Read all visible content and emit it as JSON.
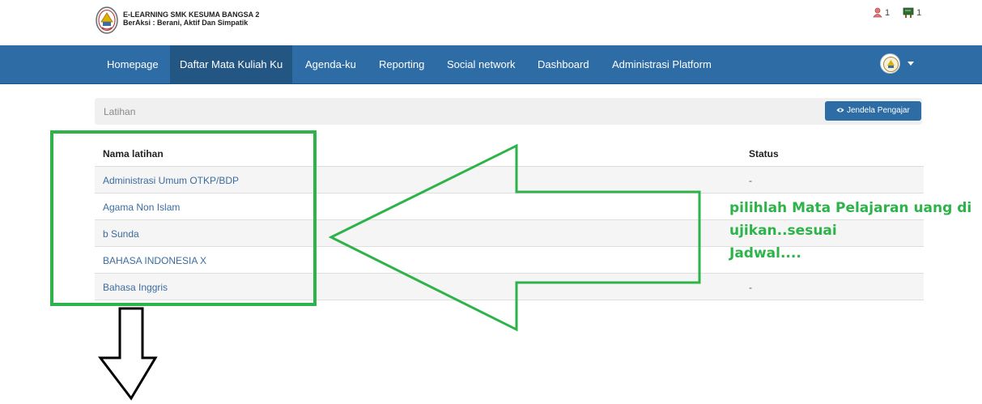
{
  "brand": {
    "title": "E-LEARNING SMK KESUMA BANGSA 2",
    "subtitle": "BerAksi : Berani, Aktif Dan Simpatik"
  },
  "counters": {
    "users": "1",
    "messages": "1"
  },
  "nav": {
    "items": [
      "Homepage",
      "Daftar Mata Kuliah Ku",
      "Agenda-ku",
      "Reporting",
      "Social network",
      "Dashboard",
      "Administrasi Platform"
    ],
    "active_index": 1
  },
  "breadcrumb": {
    "current": "Latihan"
  },
  "teacher_button": "Jendela Pengajar",
  "table": {
    "col_name": "Nama latihan",
    "col_status": "Status",
    "rows": [
      {
        "name": "Administrasi Umum OTKP/BDP",
        "status": "-"
      },
      {
        "name": "Agama Non Islam",
        "status": ""
      },
      {
        "name": "b Sunda",
        "status": ""
      },
      {
        "name": "BAHASA INDONESIA X",
        "status": ""
      },
      {
        "name": "Bahasa Inggris",
        "status": "-"
      }
    ]
  },
  "annotation": {
    "lines": [
      "pilihlah Mata Pelajaran uang di",
      "ujikan..sesuai",
      "Jadwal...."
    ],
    "color": "#2eb34a"
  },
  "colors": {
    "navbar": "#2e6ca5",
    "nav_active": "#235682",
    "link": "#3c6c9f"
  }
}
